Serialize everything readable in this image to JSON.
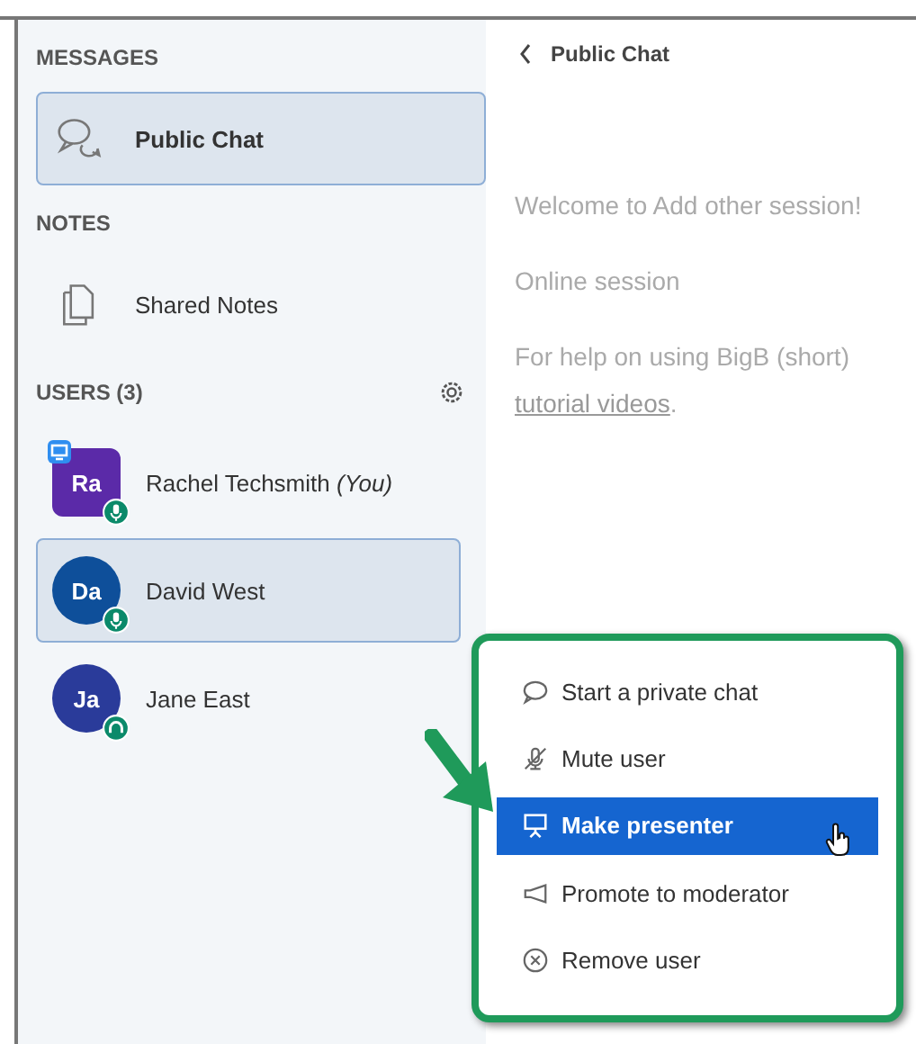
{
  "sidebar": {
    "messages_heading": "MESSAGES",
    "messages": [
      {
        "label": "Public Chat",
        "kind": "chat",
        "selected": true
      }
    ],
    "notes_heading": "NOTES",
    "notes": [
      {
        "label": "Shared Notes",
        "kind": "notes",
        "selected": false
      }
    ],
    "users_heading": "USERS (3)",
    "users": [
      {
        "initials": "Ra",
        "name": "Rachel Techsmith",
        "suffix": "(You)",
        "moderator": true,
        "color": "#5b2aa8",
        "presenter": true,
        "kind": "mic",
        "selected": false
      },
      {
        "initials": "Da",
        "name": "David West",
        "moderator": false,
        "color": "#0e4f9a",
        "presenter": false,
        "kind": "mic",
        "selected": true
      },
      {
        "initials": "Ja",
        "name": "Jane East",
        "moderator": false,
        "color": "#2a3b9a",
        "presenter": false,
        "kind": "listen",
        "selected": false
      }
    ]
  },
  "chat": {
    "title": "Public Chat",
    "messages": [
      {
        "text": "Welcome to Add other session!"
      },
      {
        "text": "Online session"
      },
      {
        "text": "For help on using BigB",
        "link_prefix": "(short) ",
        "link": "tutorial videos",
        "link_suffix": "."
      }
    ]
  },
  "context_menu": {
    "items": [
      {
        "label": "Start a private chat",
        "kind": "chat",
        "selected": false
      },
      {
        "label": "Mute user",
        "kind": "mute",
        "selected": false
      },
      {
        "label": "Make presenter",
        "kind": "presenter",
        "selected": true
      },
      {
        "label": "Promote to moderator",
        "kind": "promote",
        "selected": false
      },
      {
        "label": "Remove user",
        "kind": "remove",
        "selected": false
      }
    ]
  }
}
